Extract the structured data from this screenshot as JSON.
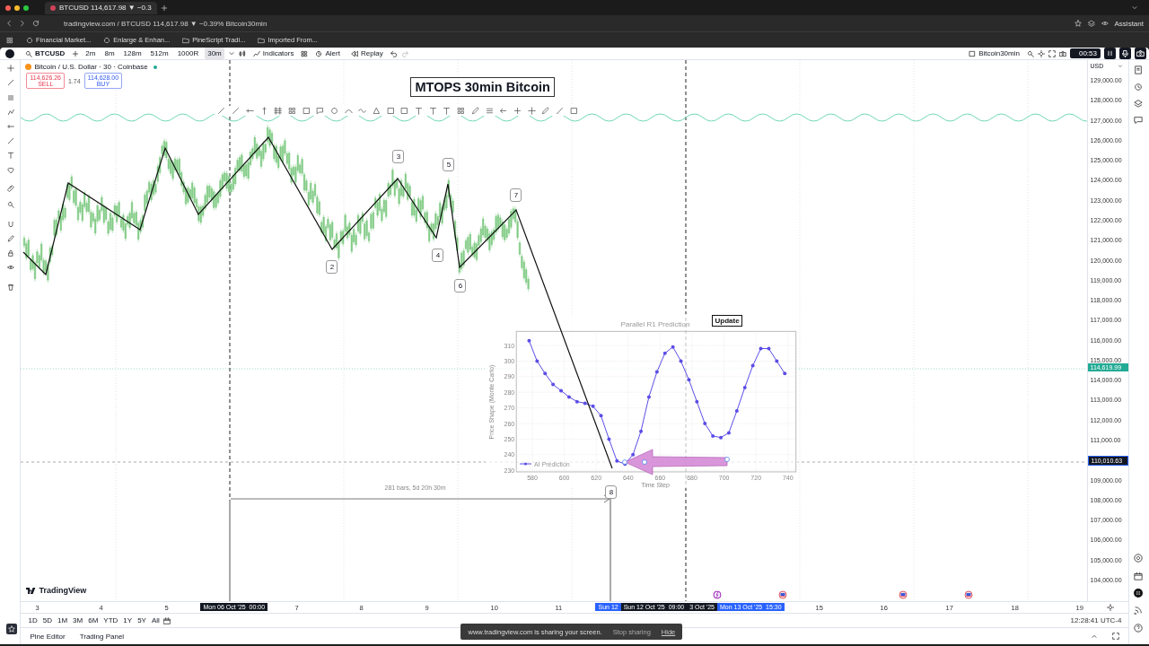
{
  "browser": {
    "tab_title": "BTCUSD 114,617.98 ▼ −0.3",
    "address": "tradingview.com / BTCUSD 114,617.98 ▼ −0.39% Bitcoin30min",
    "bookmarks": [
      "Financial Market...",
      "Enlarge & Enhan...",
      "PineScript Tradi...",
      "Imported From..."
    ],
    "assistant": "Assistant"
  },
  "toolbar": {
    "symbol": "BTCUSD",
    "intervals": [
      {
        "label": "2m",
        "selected": false
      },
      {
        "label": "8m",
        "selected": false
      },
      {
        "label": "128m",
        "selected": false
      },
      {
        "label": "512m",
        "selected": false
      },
      {
        "label": "1000R",
        "selected": false
      },
      {
        "label": "30m",
        "selected": true
      }
    ],
    "indicators": "Indicators",
    "alert": "Alert",
    "replay": "Replay",
    "layout_name": "Bitcoin30min",
    "recording_time": "00:53"
  },
  "legend": {
    "title": "Bitcoin / U.S. Dollar · 30 · Coinbase",
    "sell_price": "114,626.26",
    "sell_label": "SELL",
    "spread": "1.74",
    "buy_price": "114,628.00",
    "buy_label": "BUY"
  },
  "chart_title": "MTOPS 30min Bitcoin",
  "wave_labels": [
    "2",
    "3",
    "4",
    "5",
    "6",
    "7",
    "8"
  ],
  "measure_label": "281 bars, 5d 20h 30m",
  "update_button": "Update",
  "inset": {
    "chart_data": {
      "type": "line",
      "title": "Parallel R1 Prediction",
      "xlabel": "Time Step",
      "ylabel": "Price Shape (Monte Carlo)",
      "x": [
        578,
        583,
        588,
        593,
        598,
        603,
        608,
        613,
        618,
        623,
        628,
        633,
        638,
        643,
        648,
        653,
        658,
        663,
        668,
        673,
        678,
        683,
        688,
        693,
        698,
        703,
        708,
        713,
        718,
        723,
        728,
        733,
        738
      ],
      "series": [
        {
          "name": "AI Prediction",
          "color": "#5b4de6",
          "values": [
            313,
            300,
            292,
            285,
            281,
            277,
            274,
            273,
            271,
            265,
            250,
            236,
            234,
            240,
            255,
            277,
            293,
            305,
            309,
            300,
            288,
            274,
            260,
            252,
            251,
            254,
            268,
            283,
            297,
            308,
            308,
            300,
            292
          ]
        }
      ],
      "xlim": [
        570,
        745
      ],
      "ylim": [
        229,
        319
      ],
      "xticks": [
        580,
        600,
        620,
        640,
        660,
        680,
        700,
        720,
        740
      ],
      "yticks": [
        230,
        240,
        250,
        260,
        270,
        280,
        290,
        300,
        310
      ],
      "grid": true
    }
  },
  "price_axis": {
    "currency": "USD",
    "ticks": [
      "129,000.00",
      "128,000.00",
      "127,000.00",
      "126,000.00",
      "125,000.00",
      "124,000.00",
      "123,000.00",
      "122,000.00",
      "121,000.00",
      "120,000.00",
      "119,000.00",
      "118,000.00",
      "117,000.00",
      "116,000.00",
      "115,000.00",
      "114,000.00",
      "113,000.00",
      "112,000.00",
      "111,000.00",
      "109,000.00",
      "108,000.00",
      "107,000.00",
      "106,000.00",
      "105,000.00",
      "104,000.00"
    ],
    "last_price": "114,619.99",
    "crosshair_price": "110,010.63"
  },
  "time_axis": {
    "ticks": [
      "3",
      "4",
      "5",
      "7",
      "8",
      "9",
      "10",
      "11",
      "15",
      "16",
      "17",
      "18",
      "19"
    ],
    "crosshair_start": "Mon 06 Oct '25  00:00",
    "range_start": "Sun 12",
    "crosshair_time": "Sun 12 Oct '25  09:00",
    "covered_date": "3 Oct '25",
    "range_end": "Mon 13 Oct '25  15:30"
  },
  "logo": "TradingView",
  "ranges": [
    "1D",
    "5D",
    "1M",
    "3M",
    "6M",
    "YTD",
    "1Y",
    "5Y",
    "All"
  ],
  "clock": "12:28:41 UTC-4",
  "bottom_tabs": [
    "Pine Editor",
    "Trading Panel"
  ],
  "share_notice": {
    "message": "www.tradingview.com is sharing your screen.",
    "stop": "Stop sharing",
    "hide": "Hide"
  }
}
